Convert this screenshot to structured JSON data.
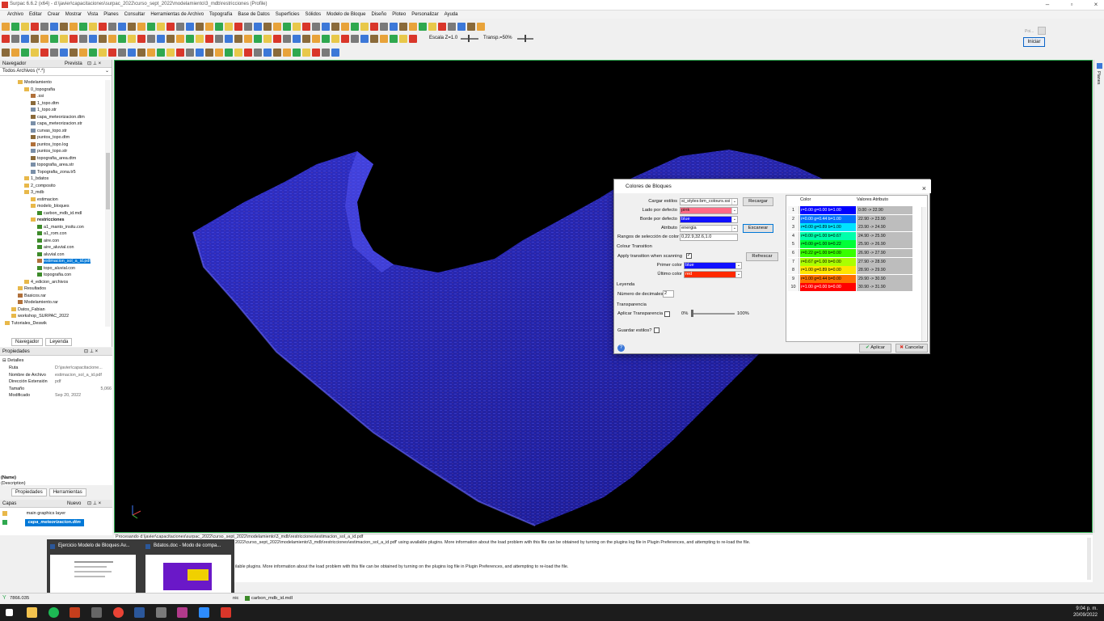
{
  "window": {
    "title": "Surpac 6.6.2 (x64) - d:\\javier\\capacitaciones\\surpac_2022\\curso_sept_2022\\modelamiento\\3_mdb\\restricciones (Profile)"
  },
  "menu": [
    "Archivo",
    "Editar",
    "Crear",
    "Mostrar",
    "Vista",
    "Planes",
    "Consultar",
    "Herramientas de Archivo",
    "Topografía",
    "Base de Datos",
    "Superficies",
    "Sólidos",
    "Modelo de Bloque",
    "Diseño",
    "Ploteo",
    "Personalizar",
    "Ayuda"
  ],
  "toolbar": {
    "escala": "Escala Z=1.0",
    "transp": "Transp.=50%",
    "iniciar": "Iniciar",
    "poi": "Poi..."
  },
  "navigator": {
    "title": "Navegador",
    "preview": "Prevista",
    "filter": "Todos Archivos (*.*)",
    "items": [
      {
        "label": "Modelamiento",
        "type": "fold",
        "indent": 2
      },
      {
        "label": "0_topografia",
        "type": "fold",
        "indent": 3
      },
      {
        "label": ".ssi",
        "type": "file",
        "indent": 4
      },
      {
        "label": "1_topo.dtm",
        "type": "dtm",
        "indent": 4
      },
      {
        "label": "1_topo.str",
        "type": "str",
        "indent": 4
      },
      {
        "label": "capa_meteorizacion.dtm",
        "type": "dtm",
        "indent": 4
      },
      {
        "label": "capa_meteorizacion.str",
        "type": "str",
        "indent": 4
      },
      {
        "label": "curvas_topo.str",
        "type": "str",
        "indent": 4
      },
      {
        "label": "puntos_topo.dtm",
        "type": "dtm",
        "indent": 4
      },
      {
        "label": "puntos_topo.log",
        "type": "file",
        "indent": 4
      },
      {
        "label": "puntos_topo.str",
        "type": "str",
        "indent": 4
      },
      {
        "label": "topografia_area.dtm",
        "type": "dtm",
        "indent": 4
      },
      {
        "label": "topografia_area.str",
        "type": "str",
        "indent": 4
      },
      {
        "label": "Topografia_zona.tr5",
        "type": "str",
        "indent": 4
      },
      {
        "label": "1_bdatos",
        "type": "fold",
        "indent": 3
      },
      {
        "label": "2_composito",
        "type": "fold",
        "indent": 3
      },
      {
        "label": "3_mdb",
        "type": "fold",
        "indent": 3
      },
      {
        "label": "estimacion",
        "type": "fold",
        "indent": 4
      },
      {
        "label": "modelo_bloques",
        "type": "fold",
        "indent": 4
      },
      {
        "label": "carbon_mdb_id.mdl",
        "type": "con",
        "indent": 5
      },
      {
        "label": "restricciones",
        "type": "fold",
        "indent": 4
      },
      {
        "label": "a1_manto_insitu.con",
        "type": "con",
        "indent": 5
      },
      {
        "label": "a1_rom.con",
        "type": "con",
        "indent": 5
      },
      {
        "label": "aire.con",
        "type": "con",
        "indent": 5
      },
      {
        "label": "aire_aluvial.con",
        "type": "con",
        "indent": 5
      },
      {
        "label": "aluvial.con",
        "type": "con",
        "indent": 5
      },
      {
        "label": "estimacion_sol_a_id.pdf",
        "type": "file",
        "indent": 5,
        "selected": true
      },
      {
        "label": "topo_aluvial.con",
        "type": "con",
        "indent": 5
      },
      {
        "label": "topografia.con",
        "type": "con",
        "indent": 5
      },
      {
        "label": "4_edicion_archivos",
        "type": "fold",
        "indent": 3
      },
      {
        "label": "Resultados",
        "type": "fold",
        "indent": 2
      },
      {
        "label": "Basicos.rar",
        "type": "file",
        "indent": 2
      },
      {
        "label": "Modelamiento.rar",
        "type": "file",
        "indent": 2
      },
      {
        "label": "Datos_Fabian",
        "type": "fold",
        "indent": 1
      },
      {
        "label": "workshop_SURPAC_2022",
        "type": "fold",
        "indent": 1
      },
      {
        "label": "Tutoriales_Deswik",
        "type": "fold",
        "indent": 0
      }
    ],
    "tabs": [
      "Navegador",
      "Leyenda"
    ]
  },
  "properties": {
    "title": "Propiedades",
    "section": "Detalles",
    "rows": [
      {
        "k": "Ruta",
        "v": "D:\\javier\\capacitacione..."
      },
      {
        "k": "Nombre de Archivo",
        "v": "estimacion_sol_a_id.pdf"
      },
      {
        "k": "Dirección Extensión",
        "v": "pdf"
      },
      {
        "k": "Tamaño",
        "v": "5,066"
      },
      {
        "k": "Modificado",
        "v": "Sep 20, 2022"
      }
    ],
    "name": "(Name)",
    "description": "(Description)",
    "tabs": [
      "Propiedades",
      "Herramientas"
    ]
  },
  "layers": {
    "title": "Capas",
    "new": "Nuevo",
    "items": [
      "main graphics layer",
      "capa_meteorizacion.dtm"
    ]
  },
  "dialog": {
    "title": "Colores de Bloques",
    "cargar_label": "Cargar estilos",
    "cargar_value": "si_styles:bm_colours.ssi",
    "recargar": "Recargar",
    "lado_label": "Lado por defecto",
    "lado_value": "pink",
    "borde_label": "Borde por defecto",
    "borde_value": "blue",
    "atributo_label": "Atributo",
    "atributo_value": "energia",
    "escanear": "Escanear",
    "rangos_label": "Rangos de selección de color",
    "rangos_value": "0,22.9,32.6,1.0",
    "transition_section": "Colour Transition",
    "apply_transition": "Apply transition when scanning",
    "refrescar": "Refrescar",
    "primer_label": "Primer color",
    "primer_value": "blue",
    "ultimo_label": "Último color",
    "ultimo_value": "red",
    "leyenda_section": "Leyenda",
    "decimales_label": "Número de decimales",
    "decimales_value": "2",
    "transp_section": "Transparencia",
    "aplicar_transp": "Aplicar Transparencia",
    "pct_min": "0%",
    "pct_max": "100%",
    "guardar": "Guardar estilos?",
    "aplicar": "Aplicar",
    "cancelar": "Cancelar",
    "table": {
      "col_color": "Color",
      "col_valores": "Valores Atributo",
      "rows": [
        {
          "n": "1",
          "rgb": "r=0.00 g=0.00 b=1.00",
          "bg": "#0000ff",
          "fg": "#fff",
          "v": "0.00 -> 22.90"
        },
        {
          "n": "2",
          "rgb": "r=0.00 g=0.44 b=1.00",
          "bg": "#0070ff",
          "fg": "#fff",
          "v": "22.90 -> 23.90"
        },
        {
          "n": "3",
          "rgb": "r=0.00 g=0.89 b=1.00",
          "bg": "#00e3ff",
          "fg": "#000",
          "v": "23.90 -> 24.90"
        },
        {
          "n": "4",
          "rgb": "r=0.00 g=1.00 b=0.67",
          "bg": "#00ffab",
          "fg": "#000",
          "v": "24.90 -> 25.90"
        },
        {
          "n": "5",
          "rgb": "r=0.00 g=1.00 b=0.22",
          "bg": "#00ff38",
          "fg": "#000",
          "v": "25.90 -> 26.90"
        },
        {
          "n": "6",
          "rgb": "r=0.22 g=1.00 b=0.00",
          "bg": "#38ff00",
          "fg": "#000",
          "v": "26.90 -> 27.90"
        },
        {
          "n": "7",
          "rgb": "r=0.67 g=1.00 b=0.00",
          "bg": "#abff00",
          "fg": "#000",
          "v": "27.90 -> 28.90"
        },
        {
          "n": "8",
          "rgb": "r=1.00 g=0.89 b=0.00",
          "bg": "#ffe300",
          "fg": "#000",
          "v": "28.90 -> 29.90"
        },
        {
          "n": "9",
          "rgb": "r=1.00 g=0.44 b=0.00",
          "bg": "#ff7000",
          "fg": "#000",
          "v": "29.90 -> 30.90"
        },
        {
          "n": "10",
          "rgb": "r=1.00 g=0.00 b=0.00",
          "bg": "#ff0000",
          "fg": "#fff",
          "v": "30.90 -> 31.90"
        }
      ]
    }
  },
  "console": {
    "line1": "Procesando d:\\javier\\capacitaciones\\surpac_2022\\curso_sept_2022\\modelamiento\\3_mdb\\restricciones\\estimacion_sol_a_id.pdf",
    "line2": "2022\\curso_sept_2022\\modelamiento\\3_mdb\\restricciones\\estimacion_sol_a_id.pdf' using available plugins.  More information about the load problem with this file can be obtained by turning on the plugins log file in Plugin Preferences, and attempting to re-load the file.",
    "line3": "ilable plugins.  More information about the load problem with this file can be obtained by turning on the plugins log file in Plugin Preferences, and attempting to re-load the file."
  },
  "thumbnails": [
    "Ejercicio Modelo de Bloques Av...",
    "Bdatos.doc  -  Modo de compa..."
  ],
  "status": {
    "coord": "7866.035",
    "file": "carbon_mdb_id.mdl",
    "mode": "nic"
  },
  "right_strip": "Planes",
  "clock": {
    "time": "9:04 p. m.",
    "date": "20/09/2022"
  }
}
